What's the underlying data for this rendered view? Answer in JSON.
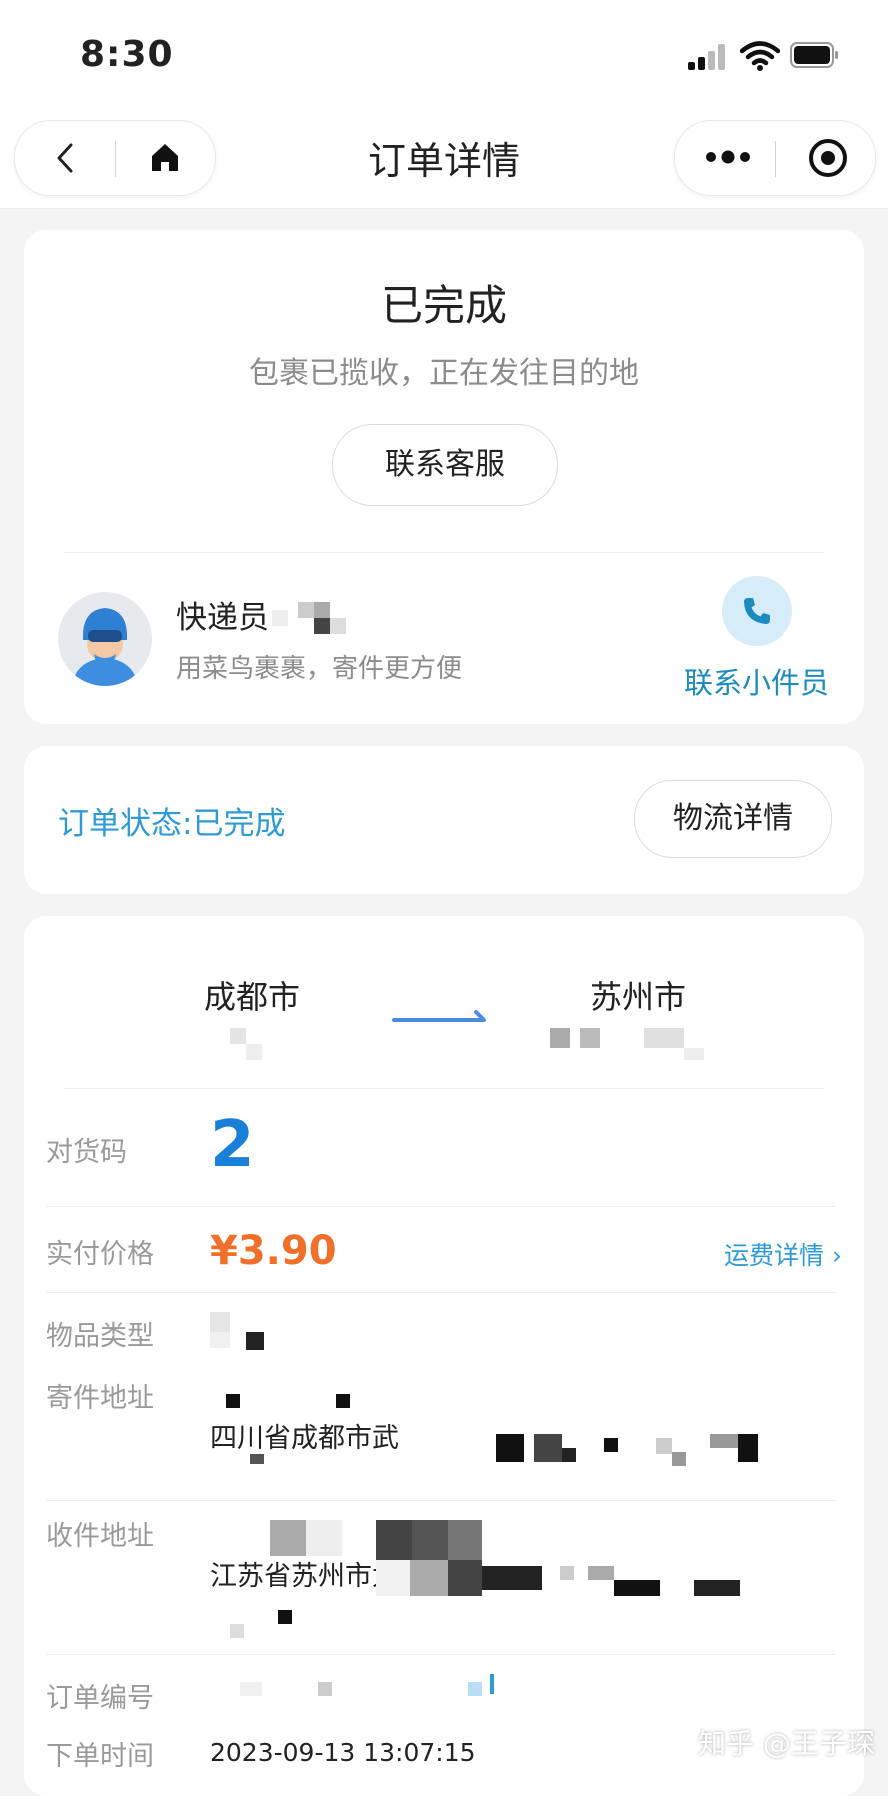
{
  "status_bar": {
    "time": "8:30"
  },
  "navbar": {
    "title": "订单详情"
  },
  "status_card": {
    "title": "已完成",
    "subtitle": "包裹已揽收，正在发往目的地",
    "contact_service_label": "联系客服",
    "courier_label": "快递员",
    "courier_sub": "用菜鸟裹裹，寄件更方便",
    "contact_courier_label": "联系小件员"
  },
  "order_card": {
    "status_text": "订单状态:已完成",
    "logistics_label": "物流详情"
  },
  "route": {
    "from_city": "成都市",
    "to_city": "苏州市"
  },
  "details": {
    "code_label": "对货码",
    "code_value": "2",
    "price_label": "实付价格",
    "price_value": "¥3.90",
    "fee_link": "运费详情 ›",
    "item_type_label": "物品类型",
    "sender_label": "寄件地址",
    "sender_value": "四川省成都市武",
    "receiver_label": "收件地址",
    "receiver_value": "江苏省苏州市太",
    "order_no_label": "订单编号",
    "order_time_label": "下单时间",
    "order_time_value": "2023-09-13 13:07:15"
  },
  "watermark": "知乎 @王子琛",
  "colors": {
    "accent": "#2e9bd6",
    "price": "#f0702a",
    "code": "#1a7fd8"
  }
}
